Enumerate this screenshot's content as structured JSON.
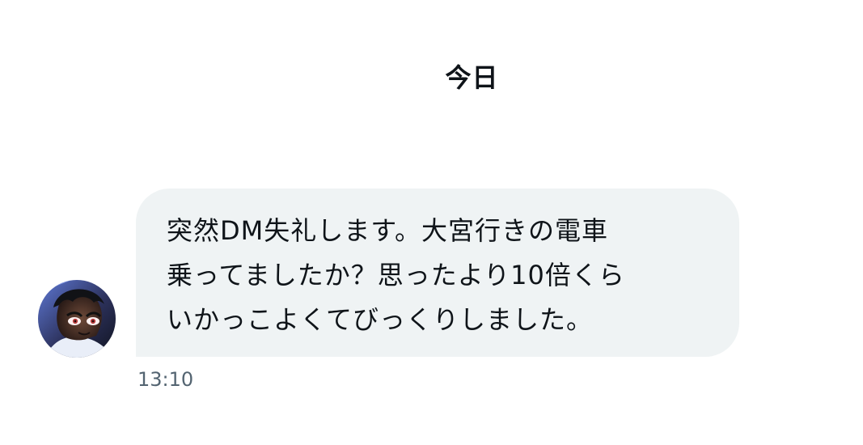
{
  "date_divider": {
    "label": "今日"
  },
  "message": {
    "lines": [
      "突然DM失礼します。大宮行きの電車",
      "乗ってましたか？思ったより10倍くら",
      "いかっこよくてびっくりしました。"
    ],
    "timestamp": "13:10",
    "avatar_icon": "user-avatar-icon",
    "bubble_color": "#eff3f4",
    "timestamp_color": "#536471"
  }
}
